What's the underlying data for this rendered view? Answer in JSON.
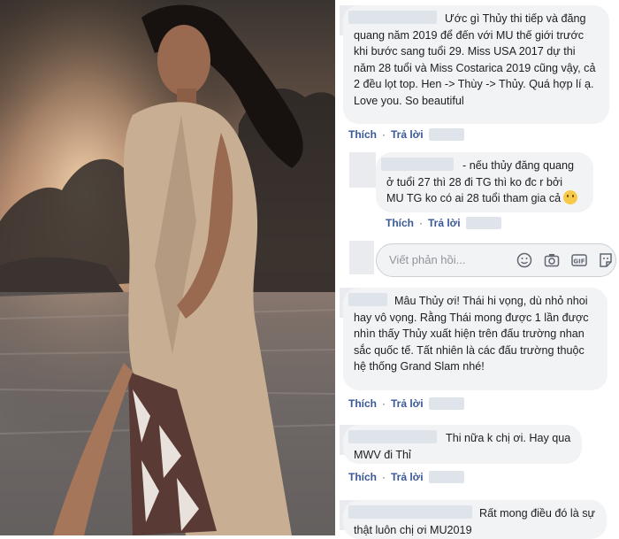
{
  "comments": [
    {
      "text": "Ước gì Thủy thi tiếp và đăng quang năm 2019 để đến với MU thế giới trước khi bước sang tuổi 29. Miss USA 2017 dự thi năm 28 tuổi và Miss Costarica 2019 cũng vậy, cả 2 đều lọt top. Hen -> Thùy -> Thủy. Quá hợp lí ạ. Love you. So beautiful",
      "like": "Thích",
      "reply": "Trả lời"
    },
    {
      "text": "- nếu thủy đăng quang ở tuổi 27 thì 28 đi TG thì ko đc r bởi MU TG ko có ai 28 tuổi tham gia cả",
      "like": "Thích",
      "reply": "Trả lời"
    },
    {
      "text": "Mâu Thủy ơi! Thái hi vọng, dù nhỏ nhoi hay vô vọng. Rằng Thái mong được 1 lần được nhìn thấy Thủy xuất hiện trên đấu trường nhan sắc quốc tế. Tất nhiên là các đấu trường thuộc hệ thống Grand Slam nhé!",
      "like": "Thích",
      "reply": "Trả lời"
    },
    {
      "text": "Thi nữa k chị ơi. Hay qua MWV đi Thỉ",
      "like": "Thích",
      "reply": "Trả lời"
    },
    {
      "text": "Rất mong điều đó là sự thật luôn chị ơi MU2019"
    }
  ],
  "reply_input": {
    "placeholder": "Viết phản hồi..."
  },
  "reply_icons": [
    "emoji-icon",
    "camera-icon",
    "gif-icon",
    "sticker-icon"
  ]
}
